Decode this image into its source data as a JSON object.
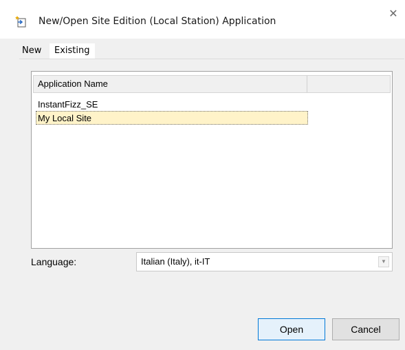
{
  "window": {
    "title": "New/Open Site Edition (Local Station) Application",
    "close_symbol": "✕"
  },
  "tabs": [
    {
      "label": "New",
      "active": false
    },
    {
      "label": "Existing",
      "active": true
    }
  ],
  "list": {
    "columns": [
      "Application Name",
      ""
    ],
    "rows": [
      {
        "name": "InstantFizz_SE",
        "selected": false
      },
      {
        "name": "My Local Site",
        "selected": true
      }
    ]
  },
  "language": {
    "label": "Language:",
    "value": "Italian (Italy), it-IT"
  },
  "buttons": {
    "open": "Open",
    "cancel": "Cancel"
  },
  "colors": {
    "selection_bg": "#fff3c9",
    "default_button_border": "#0078d7"
  },
  "icons": {
    "title": "new-application-icon",
    "close": "close-icon",
    "dropdown": "chevron-down-icon"
  }
}
